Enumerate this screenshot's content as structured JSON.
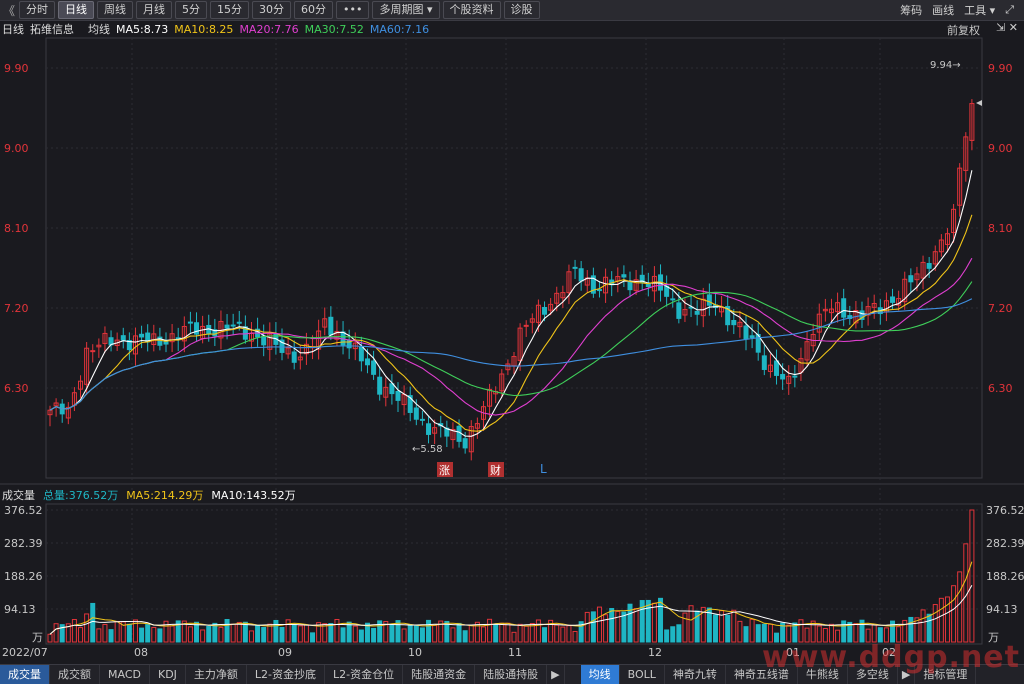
{
  "toolbar": {
    "back": "《",
    "buttons": [
      "分时",
      "日线",
      "周线",
      "月线",
      "5分",
      "15分",
      "30分",
      "60分",
      "•••",
      "多周期图 ▾",
      "个股资料",
      "诊股"
    ],
    "active_index": 1,
    "right": [
      "筹码",
      "画线",
      "工具 ▾",
      "⤢"
    ]
  },
  "ma_header": {
    "period": "日线",
    "name": "拓维信息",
    "label": "均线",
    "ma5": "MA5:8.73",
    "ma10": "MA10:8.25",
    "ma20": "MA20:7.76",
    "ma30": "MA30:7.52",
    "ma60": "MA60:7.16",
    "restore": "前复权"
  },
  "price_axis": {
    "ticks": [
      "9.90",
      "9.00",
      "8.10",
      "7.20",
      "6.30"
    ],
    "tick_values": [
      9.9,
      9.0,
      8.1,
      7.2,
      6.3
    ]
  },
  "annotations": {
    "high": "9.94→",
    "low": "←5.58",
    "events": [
      "涨",
      "财",
      "L"
    ]
  },
  "volume_header": {
    "title": "成交量",
    "total": "总量:376.52万",
    "ma5": "MA5:214.29万",
    "ma10": "MA10:143.52万"
  },
  "volume_axis": {
    "ticks": [
      "376.52",
      "282.39",
      "188.26",
      "94.13"
    ],
    "unit": "万"
  },
  "date_axis": {
    "labels": [
      "2022/07",
      "08",
      "09",
      "10",
      "11",
      "12",
      "01",
      "02"
    ]
  },
  "tabs": {
    "left": [
      "成交量",
      "成交额",
      "MACD",
      "KDJ",
      "主力净额",
      "L2-资金抄底",
      "L2-资金仓位",
      "陆股通资金",
      "陆股通持股"
    ],
    "arrow": "▶",
    "right": [
      "均线",
      "BOLL",
      "神奇九转",
      "神奇五线谱",
      "牛熊线",
      "多空线"
    ],
    "right_arrow": "▶",
    "manage": "指标管理"
  },
  "watermark": "www.ddgp.net",
  "colors": {
    "up": "#e2343a",
    "down": "#1fb6c4",
    "ma5": "#ffffff",
    "ma10": "#f0c419",
    "ma20": "#e03fd0",
    "ma30": "#3fcf5a",
    "ma60": "#3f8fe0"
  },
  "chart_data": {
    "type": "candlestick",
    "period": "日线",
    "x": [
      "2022/07",
      "08",
      "09",
      "10",
      "11",
      "12",
      "01",
      "02"
    ],
    "price_range": [
      5.58,
      9.94
    ],
    "price_ticks": [
      9.9,
      9.0,
      8.1,
      7.2,
      6.3
    ],
    "high": 9.94,
    "low": 5.58,
    "ma": {
      "MA5": 8.73,
      "MA10": 8.25,
      "MA20": 7.76,
      "MA30": 7.52,
      "MA60": 7.16
    },
    "volume": {
      "total_wan": 376.52,
      "MA5_wan": 214.29,
      "MA10_wan": 143.52,
      "ticks_wan": [
        376.52,
        282.39,
        188.26,
        94.13
      ]
    }
  }
}
